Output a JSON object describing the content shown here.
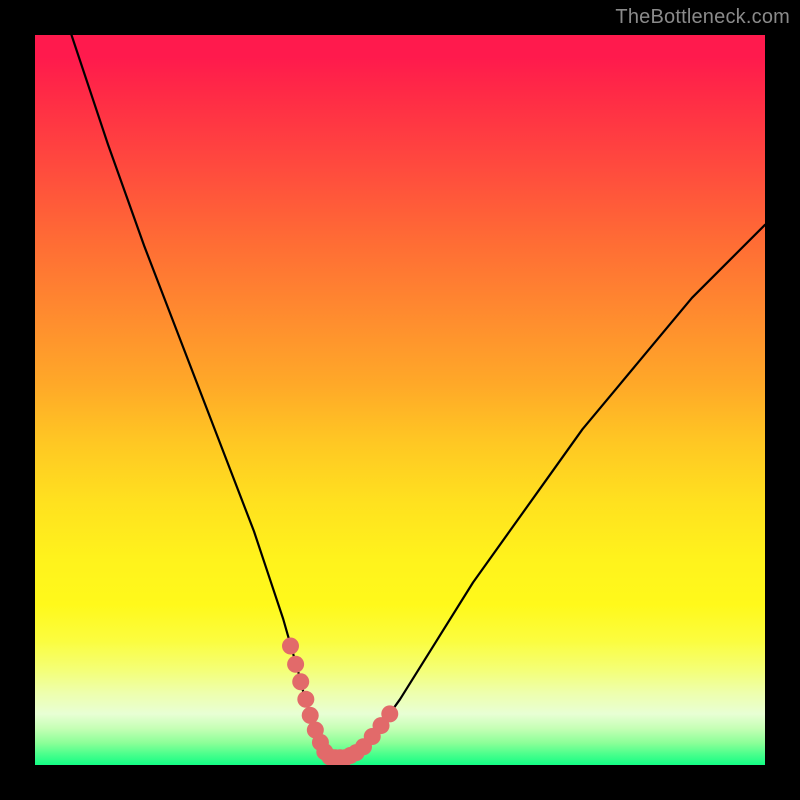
{
  "watermark": "TheBottleneck.com",
  "chart_data": {
    "type": "line",
    "title": "",
    "xlabel": "",
    "ylabel": "",
    "xlim": [
      0,
      100
    ],
    "ylim": [
      0,
      100
    ],
    "grid": false,
    "series": [
      {
        "name": "curve",
        "x": [
          5,
          10,
          15,
          20,
          25,
          30,
          32,
          34,
          36,
          37,
          38,
          39,
          40,
          41,
          42,
          43,
          45,
          50,
          55,
          60,
          65,
          70,
          75,
          80,
          85,
          90,
          95,
          100
        ],
        "values": [
          100,
          85,
          71,
          58,
          45,
          32,
          26,
          20,
          13,
          9,
          6,
          3,
          1.5,
          1,
          1,
          1.2,
          2,
          9,
          17,
          25,
          32,
          39,
          46,
          52,
          58,
          64,
          69,
          74
        ]
      }
    ],
    "markers": {
      "name": "highlight-dots",
      "color": "#e26a6a",
      "points": [
        {
          "x": 35.0,
          "y": 16.3
        },
        {
          "x": 35.7,
          "y": 13.8
        },
        {
          "x": 36.4,
          "y": 11.4
        },
        {
          "x": 37.1,
          "y": 9.0
        },
        {
          "x": 37.7,
          "y": 6.8
        },
        {
          "x": 38.4,
          "y": 4.8
        },
        {
          "x": 39.1,
          "y": 3.1
        },
        {
          "x": 39.7,
          "y": 1.8
        },
        {
          "x": 40.4,
          "y": 1.1
        },
        {
          "x": 41.1,
          "y": 1.0
        },
        {
          "x": 41.8,
          "y": 1.0
        },
        {
          "x": 42.5,
          "y": 1.0
        },
        {
          "x": 43.2,
          "y": 1.3
        },
        {
          "x": 44.0,
          "y": 1.7
        },
        {
          "x": 45.0,
          "y": 2.5
        },
        {
          "x": 46.2,
          "y": 3.9
        },
        {
          "x": 47.4,
          "y": 5.4
        },
        {
          "x": 48.6,
          "y": 7.0
        }
      ]
    },
    "background_gradient": {
      "top": "#ff1a4d",
      "mid": "#ffe11f",
      "bottom": "#14fd85"
    }
  }
}
